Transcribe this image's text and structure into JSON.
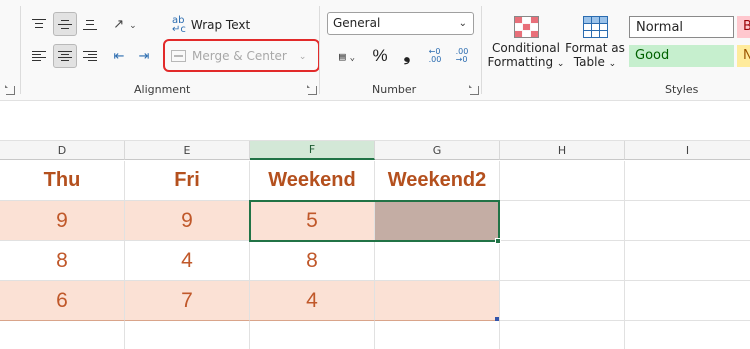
{
  "ribbon": {
    "alignment": {
      "wrap_text": "Wrap Text",
      "merge_center": "Merge & Center",
      "group_label": "Alignment"
    },
    "number": {
      "format_value": "General",
      "percent": "%",
      "comma": "❟",
      "group_label": "Number"
    },
    "styles": {
      "conditional_formatting": [
        "Conditional",
        "Formatting"
      ],
      "format_as_table": [
        "Format as",
        "Table"
      ],
      "normal": "Normal",
      "good": "Good",
      "bad_partial": "B",
      "neutral_partial": "N",
      "group_label": "Styles"
    }
  },
  "grid": {
    "columns": [
      "D",
      "E",
      "F",
      "G",
      "H",
      "I"
    ],
    "active_column": "F",
    "header_row": [
      "Thu",
      "Fri",
      "Weekend",
      "Weekend2"
    ],
    "rows": [
      [
        "9",
        "9",
        "5",
        ""
      ],
      [
        "8",
        "4",
        "8",
        ""
      ],
      [
        "6",
        "7",
        "4",
        ""
      ]
    ]
  },
  "colors": {
    "accent_green": "#217346",
    "peach_fill": "#fbe1d5",
    "selected_fill": "#c4ada4",
    "header_text": "#b4501e",
    "highlight_red": "#e22a2a"
  }
}
